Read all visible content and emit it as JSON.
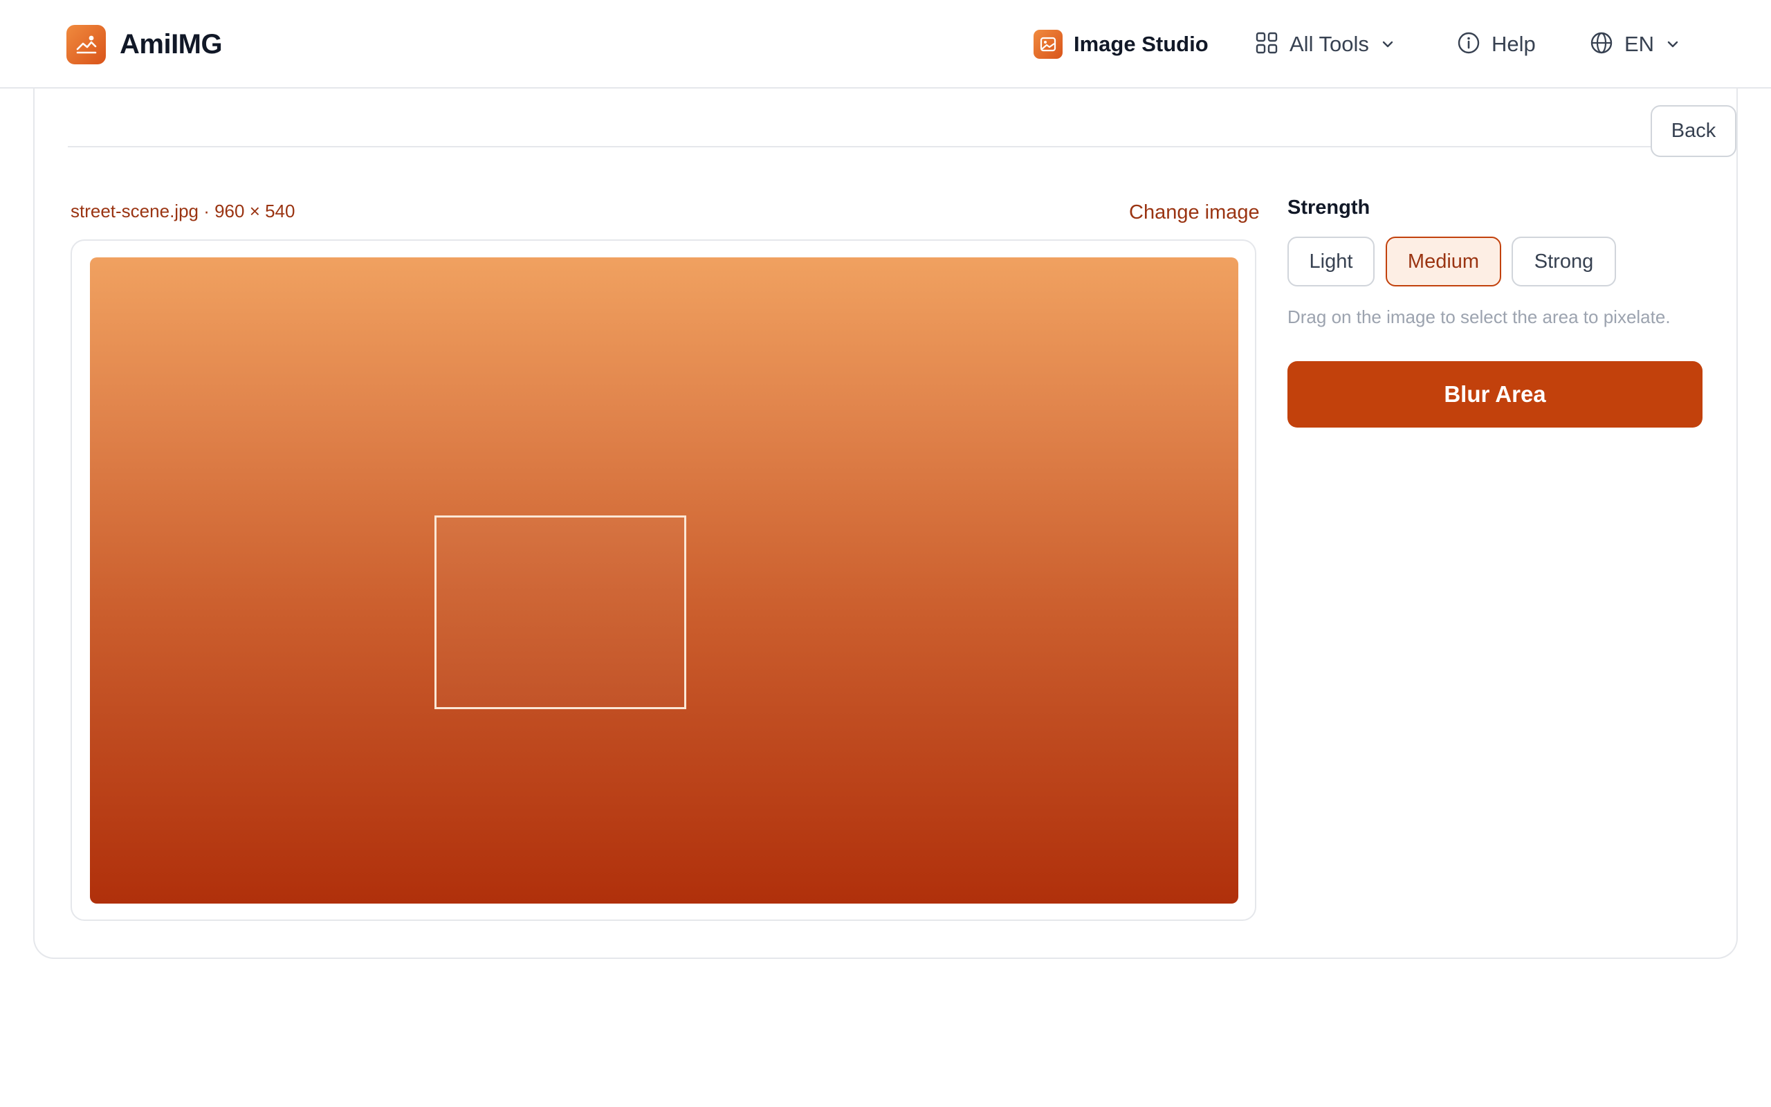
{
  "header": {
    "brand": "AmiIMG",
    "nav": {
      "studio": "Image Studio",
      "tools": "All Tools",
      "help": "Help",
      "language": "EN"
    }
  },
  "editor": {
    "back_label": "Back",
    "file_meta": "street-scene.jpg · 960 × 540",
    "change_image": "Change image"
  },
  "panel": {
    "strength_label": "Strength",
    "options": [
      "Light",
      "Medium",
      "Strong"
    ],
    "selected_option": "Medium",
    "hint": "Drag on the image to select the area to pixelate.",
    "action_label": "Blur Area"
  },
  "colors": {
    "accent": "#c2410c",
    "accent_text": "#9a3412",
    "selected_bg": "#fdeee4",
    "image_top": "#f0a160",
    "image_bottom": "#b0300b"
  },
  "icons": {
    "brand": "mountain-image-icon",
    "studio": "image-icon",
    "tools": "grid-icon",
    "help": "info-icon",
    "language": "globe-icon",
    "dropdown": "chevron-down-icon"
  }
}
